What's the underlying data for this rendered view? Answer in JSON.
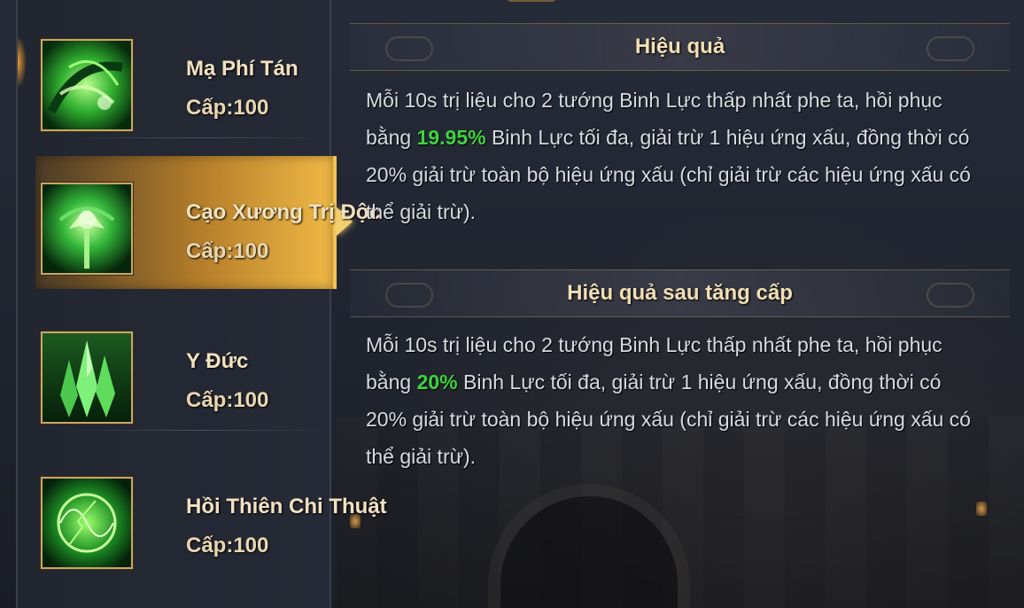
{
  "skills": [
    {
      "name": "Mạ Phí Tán",
      "level": "Cấp:100",
      "icon": "green-swirl-icon"
    },
    {
      "name": "Cạo Xương Trị Độc",
      "level": "Cấp:100",
      "icon": "green-herb-icon"
    },
    {
      "name": "Y Đức",
      "level": "Cấp:100",
      "icon": "green-crystal-icon"
    },
    {
      "name": "Hồi Thiên Chi Thuật",
      "level": "Cấp:100",
      "icon": "green-energy-icon"
    }
  ],
  "selected_index": 1,
  "effect": {
    "title": "Hiệu quả",
    "text_before": "Mỗi 10s trị liệu cho 2 tướng Binh Lực thấp nhất phe ta, hồi phục bằng ",
    "value": "19.95%",
    "text_after": " Binh Lực tối đa, giải trừ 1 hiệu ứng xấu, đồng thời có 20% giải trừ toàn bộ hiệu ứng xấu (chỉ giải trừ các hiệu ứng xấu có thể giải trừ)."
  },
  "upgrade_effect": {
    "title": "Hiệu quả sau tăng cấp",
    "text_before": "Mỗi 10s trị liệu cho 2 tướng Binh Lực thấp nhất phe ta, hồi phục bằng ",
    "value": "20%",
    "text_after": " Binh Lực tối đa, giải trừ 1 hiệu ứng xấu, đồng thời có 20% giải trừ toàn bộ hiệu ứng xấu (chỉ giải trừ các hiệu ứng xấu có thể giải trừ)."
  },
  "colors": {
    "highlight_value": "#3ed43e",
    "selected_gold": "#f3c257",
    "title_text": "#f2dfb4"
  }
}
